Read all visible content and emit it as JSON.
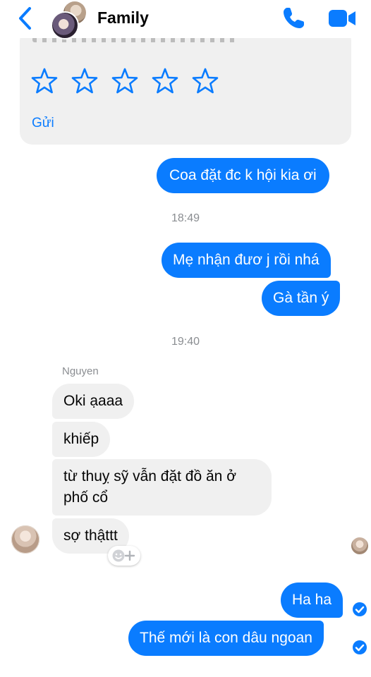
{
  "header": {
    "title": "Family",
    "icons": {
      "back": "chevron-left-icon",
      "call": "phone-icon",
      "video": "video-camera-icon"
    },
    "accent": "#0a7cff"
  },
  "rating": {
    "stars": 5,
    "send_label": "Gửi"
  },
  "messages": {
    "m1": "Coa đặt đc k hội kia ơi",
    "time1": "18:49",
    "m2": "Mẹ nhận đươ j rồi nhá",
    "m3": "Gà tần ý",
    "time2": "19:40",
    "sender_name": "Nguyen",
    "m4": "Oki ạaaa",
    "m5": "khiếp",
    "m6": "từ thuỵ sỹ vẫn đặt đồ ăn ở phố cổ",
    "m7": "sợ thậttt",
    "m8": "Ha ha",
    "m9": "Thế mới là con dâu ngoan"
  },
  "colors": {
    "outgoing_bubble": "#0a7cff",
    "incoming_bubble": "#f0f0f0",
    "timestamp": "#8a8d91"
  }
}
